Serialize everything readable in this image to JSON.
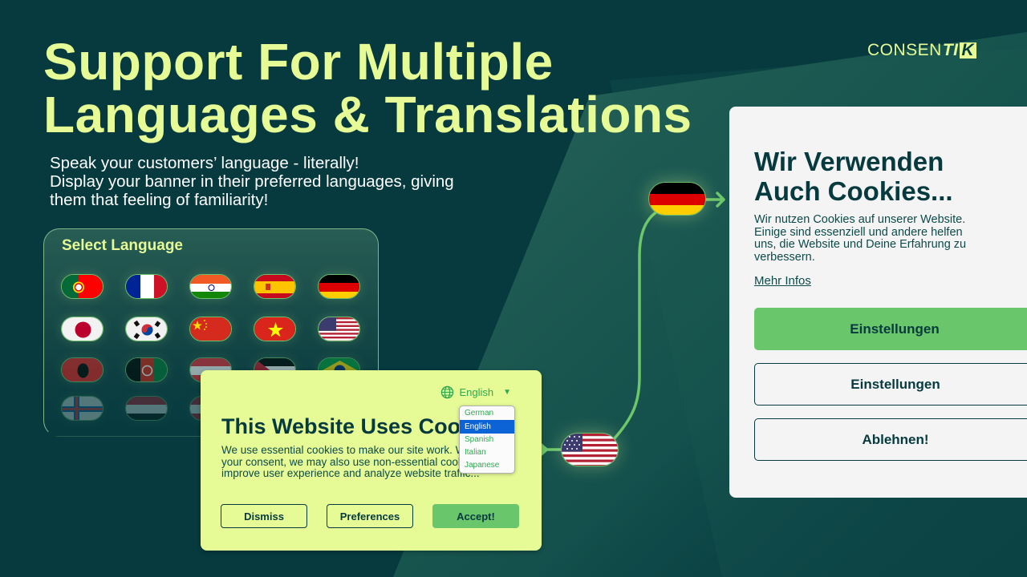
{
  "brand": {
    "logo_regular": "CONSEN",
    "logo_bold": "TI",
    "logo_box": "K",
    "colors": {
      "background": "#063a3f",
      "accent_lime": "#e6fb96",
      "accent_green": "#6ac66a",
      "dropdown_selected": "#0c63d6",
      "banner_light": "#f4f4f4"
    }
  },
  "hero": {
    "headline_lines": [
      "Support For Multiple",
      "Languages & Translations"
    ],
    "subtext_lines": [
      "Speak your customers’ language - literally!",
      "Display your banner in their preferred languages, giving",
      "them that feeling of familiarity!"
    ]
  },
  "language_panel": {
    "title": "Select Language",
    "flags": [
      [
        "flag-portugal",
        "flag-france",
        "flag-india",
        "flag-spain",
        "flag-germany"
      ],
      [
        "flag-japan",
        "flag-south-korea",
        "flag-china",
        "flag-vietnam",
        "flag-usa"
      ],
      [
        "flag-albania",
        "flag-afghanistan",
        "flag-austria",
        "flag-palestine",
        "flag-brazil"
      ],
      [
        "flag-faroe-islands",
        "flag-egypt",
        "flag-partial"
      ]
    ]
  },
  "english_banner": {
    "language_selector": {
      "icon": "globe-icon",
      "selected": "English",
      "caret": "▼",
      "options": [
        "German",
        "English",
        "Spanish",
        "Italian",
        "Japanese"
      ]
    },
    "title": "This Website Uses Cookies",
    "body_lines": [
      "We use essential cookies to make our site work. With",
      "your consent, we may also use non-essential cookies to",
      "improve user experience and analyze website traffic..."
    ],
    "buttons": {
      "dismiss": "Dismiss",
      "preferences": "Preferences",
      "accept": "Accept!"
    }
  },
  "connector": {
    "from_flag": "flag-usa",
    "to_flag": "flag-germany",
    "arrow_icon": "arrow-right-icon"
  },
  "german_banner": {
    "title_lines": [
      "Wir Verwenden",
      "Auch Cookies..."
    ],
    "body_lines": [
      "Wir nutzen Cookies auf unserer Website.",
      "Einige sind essenziell und andere helfen",
      "uns, die Website und Deine Erfahrung zu",
      "verbessern."
    ],
    "link": "Mehr Infos",
    "buttons": [
      "Einstellungen",
      "Einstellungen",
      "Ablehnen!"
    ]
  }
}
